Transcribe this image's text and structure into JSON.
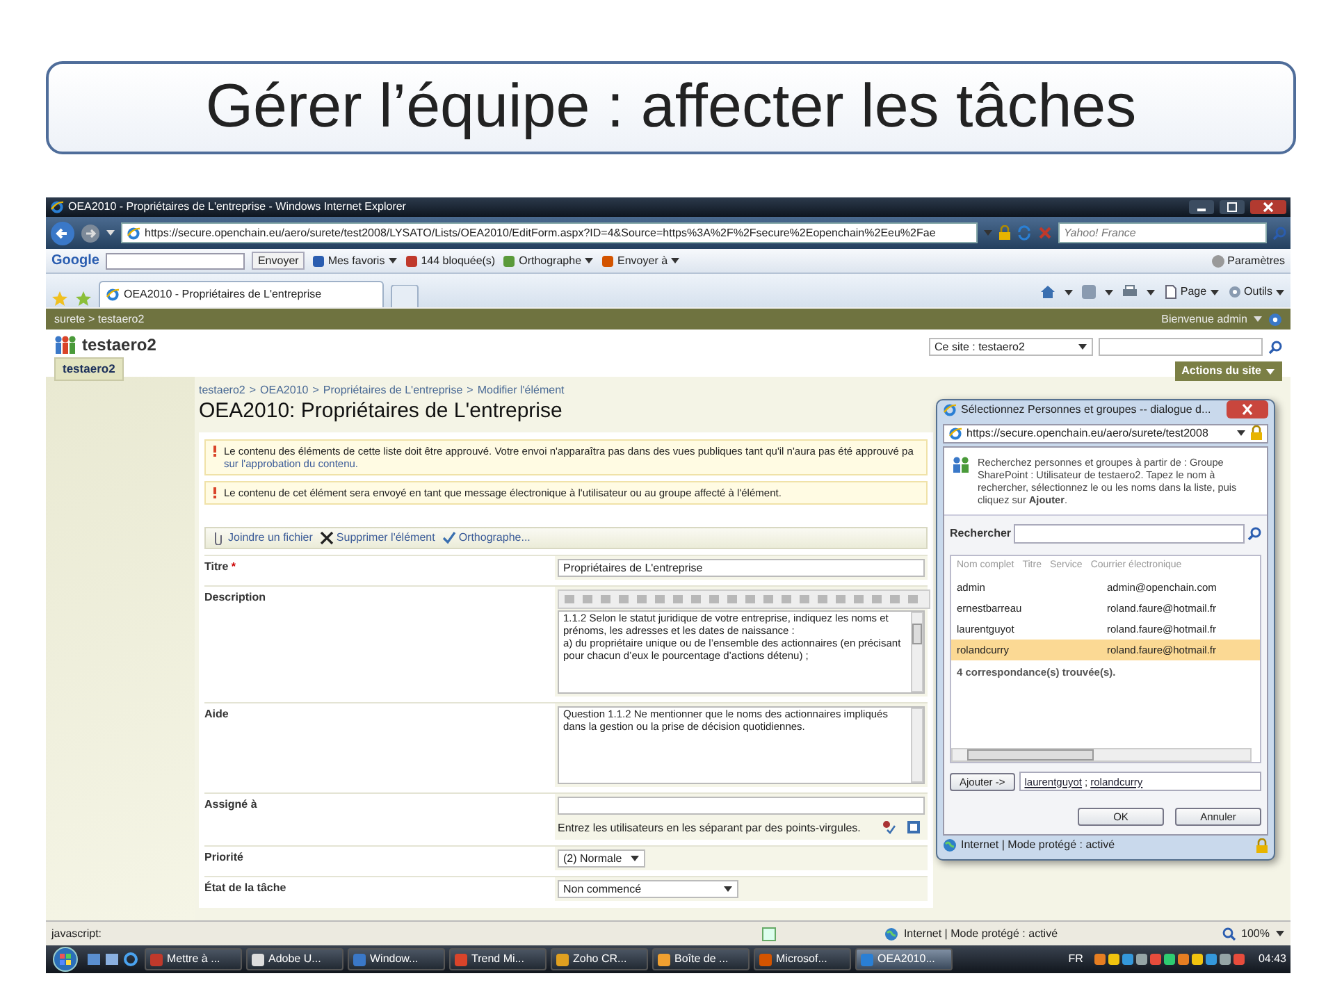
{
  "slide": {
    "title": "Gérer l’équipe : affecter les tâches"
  },
  "browser": {
    "title": "OEA2010 - Propriétaires de L'entreprise - Windows Internet Explorer",
    "address": "https://secure.openchain.eu/aero/surete/test2008/LYSATO/Lists/OEA2010/EditForm.aspx?ID=4&Source=https%3A%2F%2Fsecure%2Eopenchain%2Eeu%2Fae",
    "search_placeholder": "Yahoo! France",
    "google_toolbar": {
      "logo": "Google",
      "search_button": "Envoyer",
      "items": [
        {
          "label": "Mes favoris",
          "dropdown": true
        },
        {
          "label": "144 bloquée(s)",
          "dropdown": false
        },
        {
          "label": "Orthographe",
          "dropdown": true
        },
        {
          "label": "Envoyer à",
          "dropdown": true
        }
      ],
      "settings": "Paramètres"
    },
    "tabs": [
      {
        "label": "OEA2010 - Propriétaires de L'entreprise",
        "selected": true
      }
    ],
    "command_bar": [
      "Page",
      "Outils"
    ],
    "status_bar": {
      "text": "javascript:",
      "zone": "Internet | Mode protégé : activé",
      "zoom": "100%"
    }
  },
  "sharepoint": {
    "top_breadcrumb": "surete > testaero2",
    "welcome": "Bienvenue admin",
    "site_name": "testaero2",
    "tabs": [
      {
        "label": "testaero2",
        "selected": true
      }
    ],
    "search_scope": "Ce site : testaero2",
    "site_actions": "Actions du site",
    "breadcrumb": [
      "testaero2",
      "OEA2010",
      "Propriétaires de L'entreprise",
      "Modifier l'élément"
    ],
    "breadcrumb_separator": ">",
    "page_title": "OEA2010: Propriétaires de L'entreprise",
    "notices": [
      {
        "text": "Le contenu des éléments de cette liste doit être approuvé. Votre envoi n'apparaîtra pas dans des vues publiques tant qu'il n'aura pas été approuvé pa",
        "link": "sur l'approbation du contenu."
      },
      {
        "text": "Le contenu de cet élément sera envoyé en tant que message électronique à l'utilisateur ou au groupe affecté à l'élément."
      }
    ],
    "toolbar": [
      "Joindre un fichier",
      "Supprimer l'élément",
      "Orthographe..."
    ],
    "form": [
      {
        "kind": "text",
        "label": "Titre",
        "marker": "*",
        "value": "Propriétaires de L'entreprise"
      },
      {
        "kind": "richtext",
        "label": "Description",
        "value": "1.1.2 Selon le statut juridique de votre entreprise, indiquez les noms et prénoms, les adresses et les dates de naissance :\na) du propriétaire unique ou de l’ensemble des actionnaires (en précisant pour chacun d’eux le pourcentage d’actions détenu) ;"
      },
      {
        "kind": "textarea",
        "label": "Aide",
        "value": "Question 1.1.2 Ne mentionner que le noms des actionnaires impliqués dans la gestion ou la prise de décision quotidiennes."
      },
      {
        "kind": "people",
        "label": "Assigné à",
        "hint": "Entrez les utilisateurs en les séparant par des points-virgules."
      },
      {
        "kind": "select",
        "label": "Priorité",
        "value": "(2) Normale"
      },
      {
        "kind": "select",
        "label": "État de la tâche",
        "value": "Non commencé"
      }
    ]
  },
  "dialog": {
    "title": "Sélectionnez Personnes et groupes -- dialogue d...",
    "address": "https://secure.openchain.eu/aero/surete/test2008",
    "instructions": "Recherchez personnes et groupes à partir de : Groupe SharePoint : Utilisateur de testaero2. Tapez le nom à rechercher, sélectionnez le ou les noms dans la liste, puis cliquez sur **Ajouter**.",
    "search_label": "Rechercher",
    "columns": [
      "Nom complet",
      "Titre",
      "Service",
      "Courrier électronique"
    ],
    "rows": [
      {
        "name": "admin",
        "email": "admin@openchain.com",
        "selected": false
      },
      {
        "name": "ernestbarreau",
        "email": "roland.faure@hotmail.fr",
        "selected": false
      },
      {
        "name": "laurentguyot",
        "email": "roland.faure@hotmail.fr",
        "selected": false
      },
      {
        "name": "rolandcurry",
        "email": "roland.faure@hotmail.fr",
        "selected": true
      }
    ],
    "result_count": "4 correspondance(s) trouvée(s).",
    "add_button": "Ajouter ->",
    "picked": [
      "laurentguyot",
      "rolandcurry"
    ],
    "picked_separator": ";",
    "buttons": [
      "OK",
      "Annuler"
    ],
    "status": "Internet | Mode protégé : activé"
  },
  "taskbar": {
    "items": [
      {
        "label": "Mettre à ...",
        "selected": false
      },
      {
        "label": "Adobe U...",
        "selected": false
      },
      {
        "label": "Window...",
        "selected": false
      },
      {
        "label": "Trend Mi...",
        "selected": false
      },
      {
        "label": "Zoho CR...",
        "selected": false
      },
      {
        "label": "Boîte de ...",
        "selected": false
      },
      {
        "label": "Microsof...",
        "selected": false
      },
      {
        "label": "OEA2010...",
        "selected": true
      }
    ],
    "language": "FR",
    "clock": "04:43"
  }
}
